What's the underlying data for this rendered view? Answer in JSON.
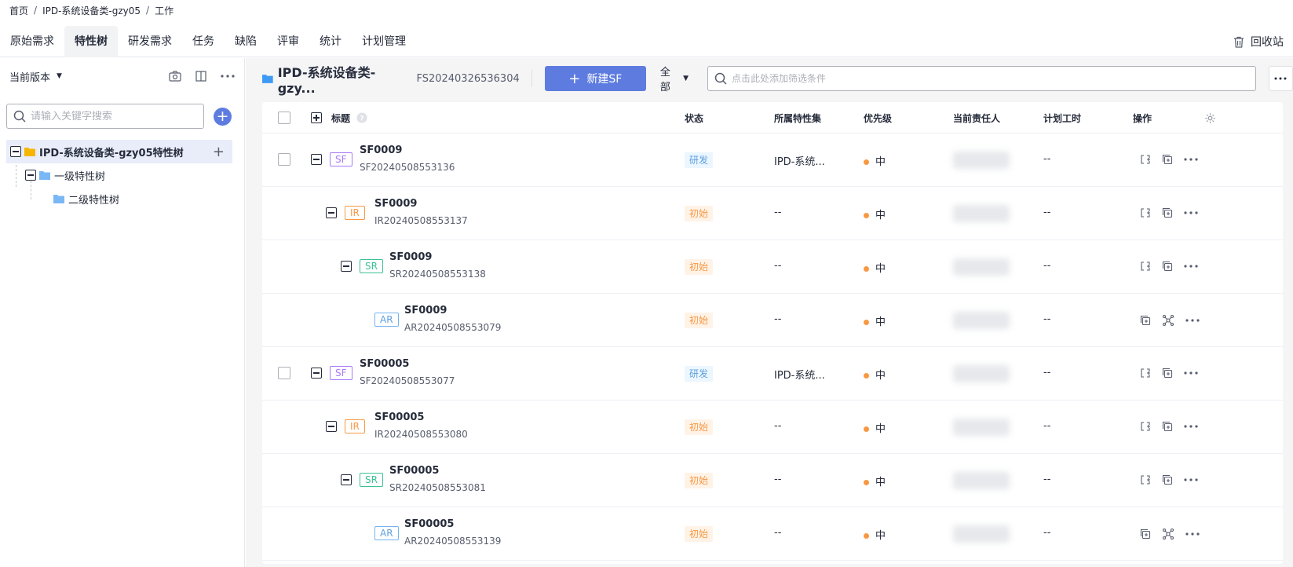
{
  "breadcrumb": {
    "home": "首页",
    "project": "IPD-系统设备类-gzy05",
    "work": "工作",
    "separator": "/"
  },
  "tabs": [
    "原始需求",
    "特性树",
    "研发需求",
    "任务",
    "缺陷",
    "评审",
    "统计",
    "计划管理"
  ],
  "active_tab": "特性树",
  "recycle_label": "回收站",
  "left": {
    "version_label": "当前版本",
    "search_placeholder": "请输入关键字搜索",
    "add_symbol": "+",
    "tree": {
      "root": "IPD-系统设备类-gzy05特性树",
      "level1": "一级特性树",
      "level2": "二级特性树"
    }
  },
  "main": {
    "title": "IPD-系统设备类-gzy...",
    "project_id": "FS20240326536304",
    "new_button": "新建SF",
    "scope": "全部",
    "filter_placeholder": "点击此处添加筛选条件"
  },
  "table": {
    "columns": {
      "title": "标题",
      "status": "状态",
      "feature_set": "所属特性集",
      "priority": "优先级",
      "owner": "当前责任人",
      "hours": "计划工时",
      "ops": "操作"
    },
    "rows": [
      {
        "level": 0,
        "checkbox": true,
        "type": "SF",
        "title": "SF0009",
        "id": "SF20240508553136",
        "status": "研发",
        "status_kind": "dev",
        "feature_set": "IPD-系统...",
        "priority": "中",
        "hours": "--",
        "ops": "split"
      },
      {
        "level": 1,
        "checkbox": false,
        "type": "IR",
        "title": "SF0009",
        "id": "IR20240508553137",
        "status": "初始",
        "status_kind": "init",
        "feature_set": "--",
        "priority": "中",
        "hours": "--",
        "ops": "split"
      },
      {
        "level": 2,
        "checkbox": false,
        "type": "SR",
        "title": "SF0009",
        "id": "SR20240508553138",
        "status": "初始",
        "status_kind": "init",
        "feature_set": "--",
        "priority": "中",
        "hours": "--",
        "ops": "split"
      },
      {
        "level": 3,
        "checkbox": false,
        "type": "AR",
        "title": "SF0009",
        "id": "AR20240508553079",
        "status": "初始",
        "status_kind": "init",
        "feature_set": "--",
        "priority": "中",
        "hours": "--",
        "ops": "network"
      },
      {
        "level": 0,
        "checkbox": true,
        "type": "SF",
        "title": "SF00005",
        "id": "SF20240508553077",
        "status": "研发",
        "status_kind": "dev",
        "feature_set": "IPD-系统...",
        "priority": "中",
        "hours": "--",
        "ops": "split"
      },
      {
        "level": 1,
        "checkbox": false,
        "type": "IR",
        "title": "SF00005",
        "id": "IR20240508553080",
        "status": "初始",
        "status_kind": "init",
        "feature_set": "--",
        "priority": "中",
        "hours": "--",
        "ops": "split"
      },
      {
        "level": 2,
        "checkbox": false,
        "type": "SR",
        "title": "SF00005",
        "id": "SR20240508553081",
        "status": "初始",
        "status_kind": "init",
        "feature_set": "--",
        "priority": "中",
        "hours": "--",
        "ops": "split"
      },
      {
        "level": 3,
        "checkbox": false,
        "type": "AR",
        "title": "SF00005",
        "id": "AR20240508553139",
        "status": "初始",
        "status_kind": "init",
        "feature_set": "--",
        "priority": "中",
        "hours": "--",
        "ops": "network"
      }
    ]
  },
  "colors": {
    "primary": "#5e7ce0",
    "sf": "#a97af8",
    "ir": "#fa9841",
    "sr": "#3ac295",
    "ar": "#74b3f0",
    "folder": "#3e9bf5",
    "root_folder": "#f7b500"
  }
}
